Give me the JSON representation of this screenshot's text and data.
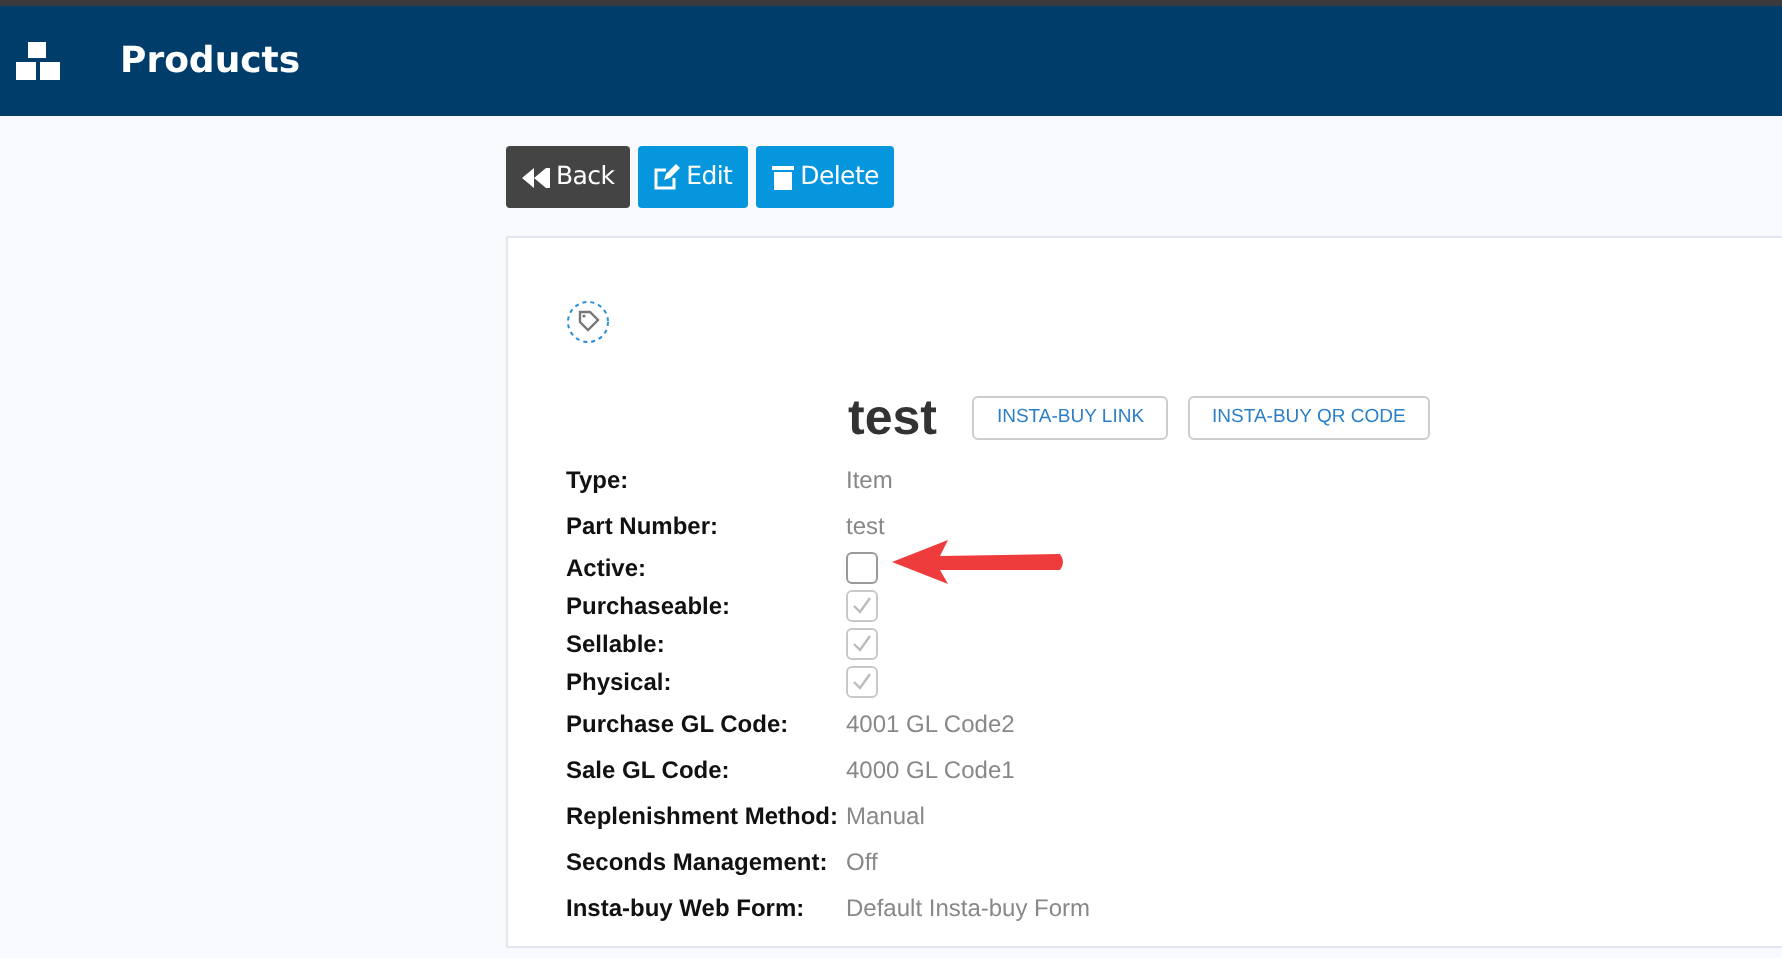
{
  "header": {
    "title": "Products"
  },
  "toolbar": [
    {
      "label": "Back",
      "kind": "back"
    },
    {
      "label": "Edit",
      "kind": "edit"
    },
    {
      "label": "Delete",
      "kind": "delete"
    }
  ],
  "product": {
    "name": "test",
    "links": [
      "INSTA-BUY LINK",
      "INSTA-BUY QR CODE"
    ]
  },
  "fields": [
    {
      "label": "Type:",
      "kind": "text",
      "value": "Item"
    },
    {
      "label": "Part Number:",
      "kind": "text",
      "value": "test"
    },
    {
      "label": "Active:",
      "kind": "checkbox",
      "checked": false,
      "disabled": false
    },
    {
      "label": "Purchaseable:",
      "kind": "checkbox",
      "checked": true,
      "disabled": true
    },
    {
      "label": "Sellable:",
      "kind": "checkbox",
      "checked": true,
      "disabled": true
    },
    {
      "label": "Physical:",
      "kind": "checkbox",
      "checked": true,
      "disabled": true
    },
    {
      "label": "Purchase GL Code:",
      "kind": "text",
      "value": "4001 GL Code2"
    },
    {
      "label": "Sale GL Code:",
      "kind": "text",
      "value": "4000 GL Code1"
    },
    {
      "label": "Replenishment Method:",
      "kind": "text",
      "value": "Manual"
    },
    {
      "label": "Seconds Management:",
      "kind": "text",
      "value": "Off"
    },
    {
      "label": "Insta-buy Web Form:",
      "kind": "text",
      "value": "Default Insta-buy Form"
    }
  ]
}
